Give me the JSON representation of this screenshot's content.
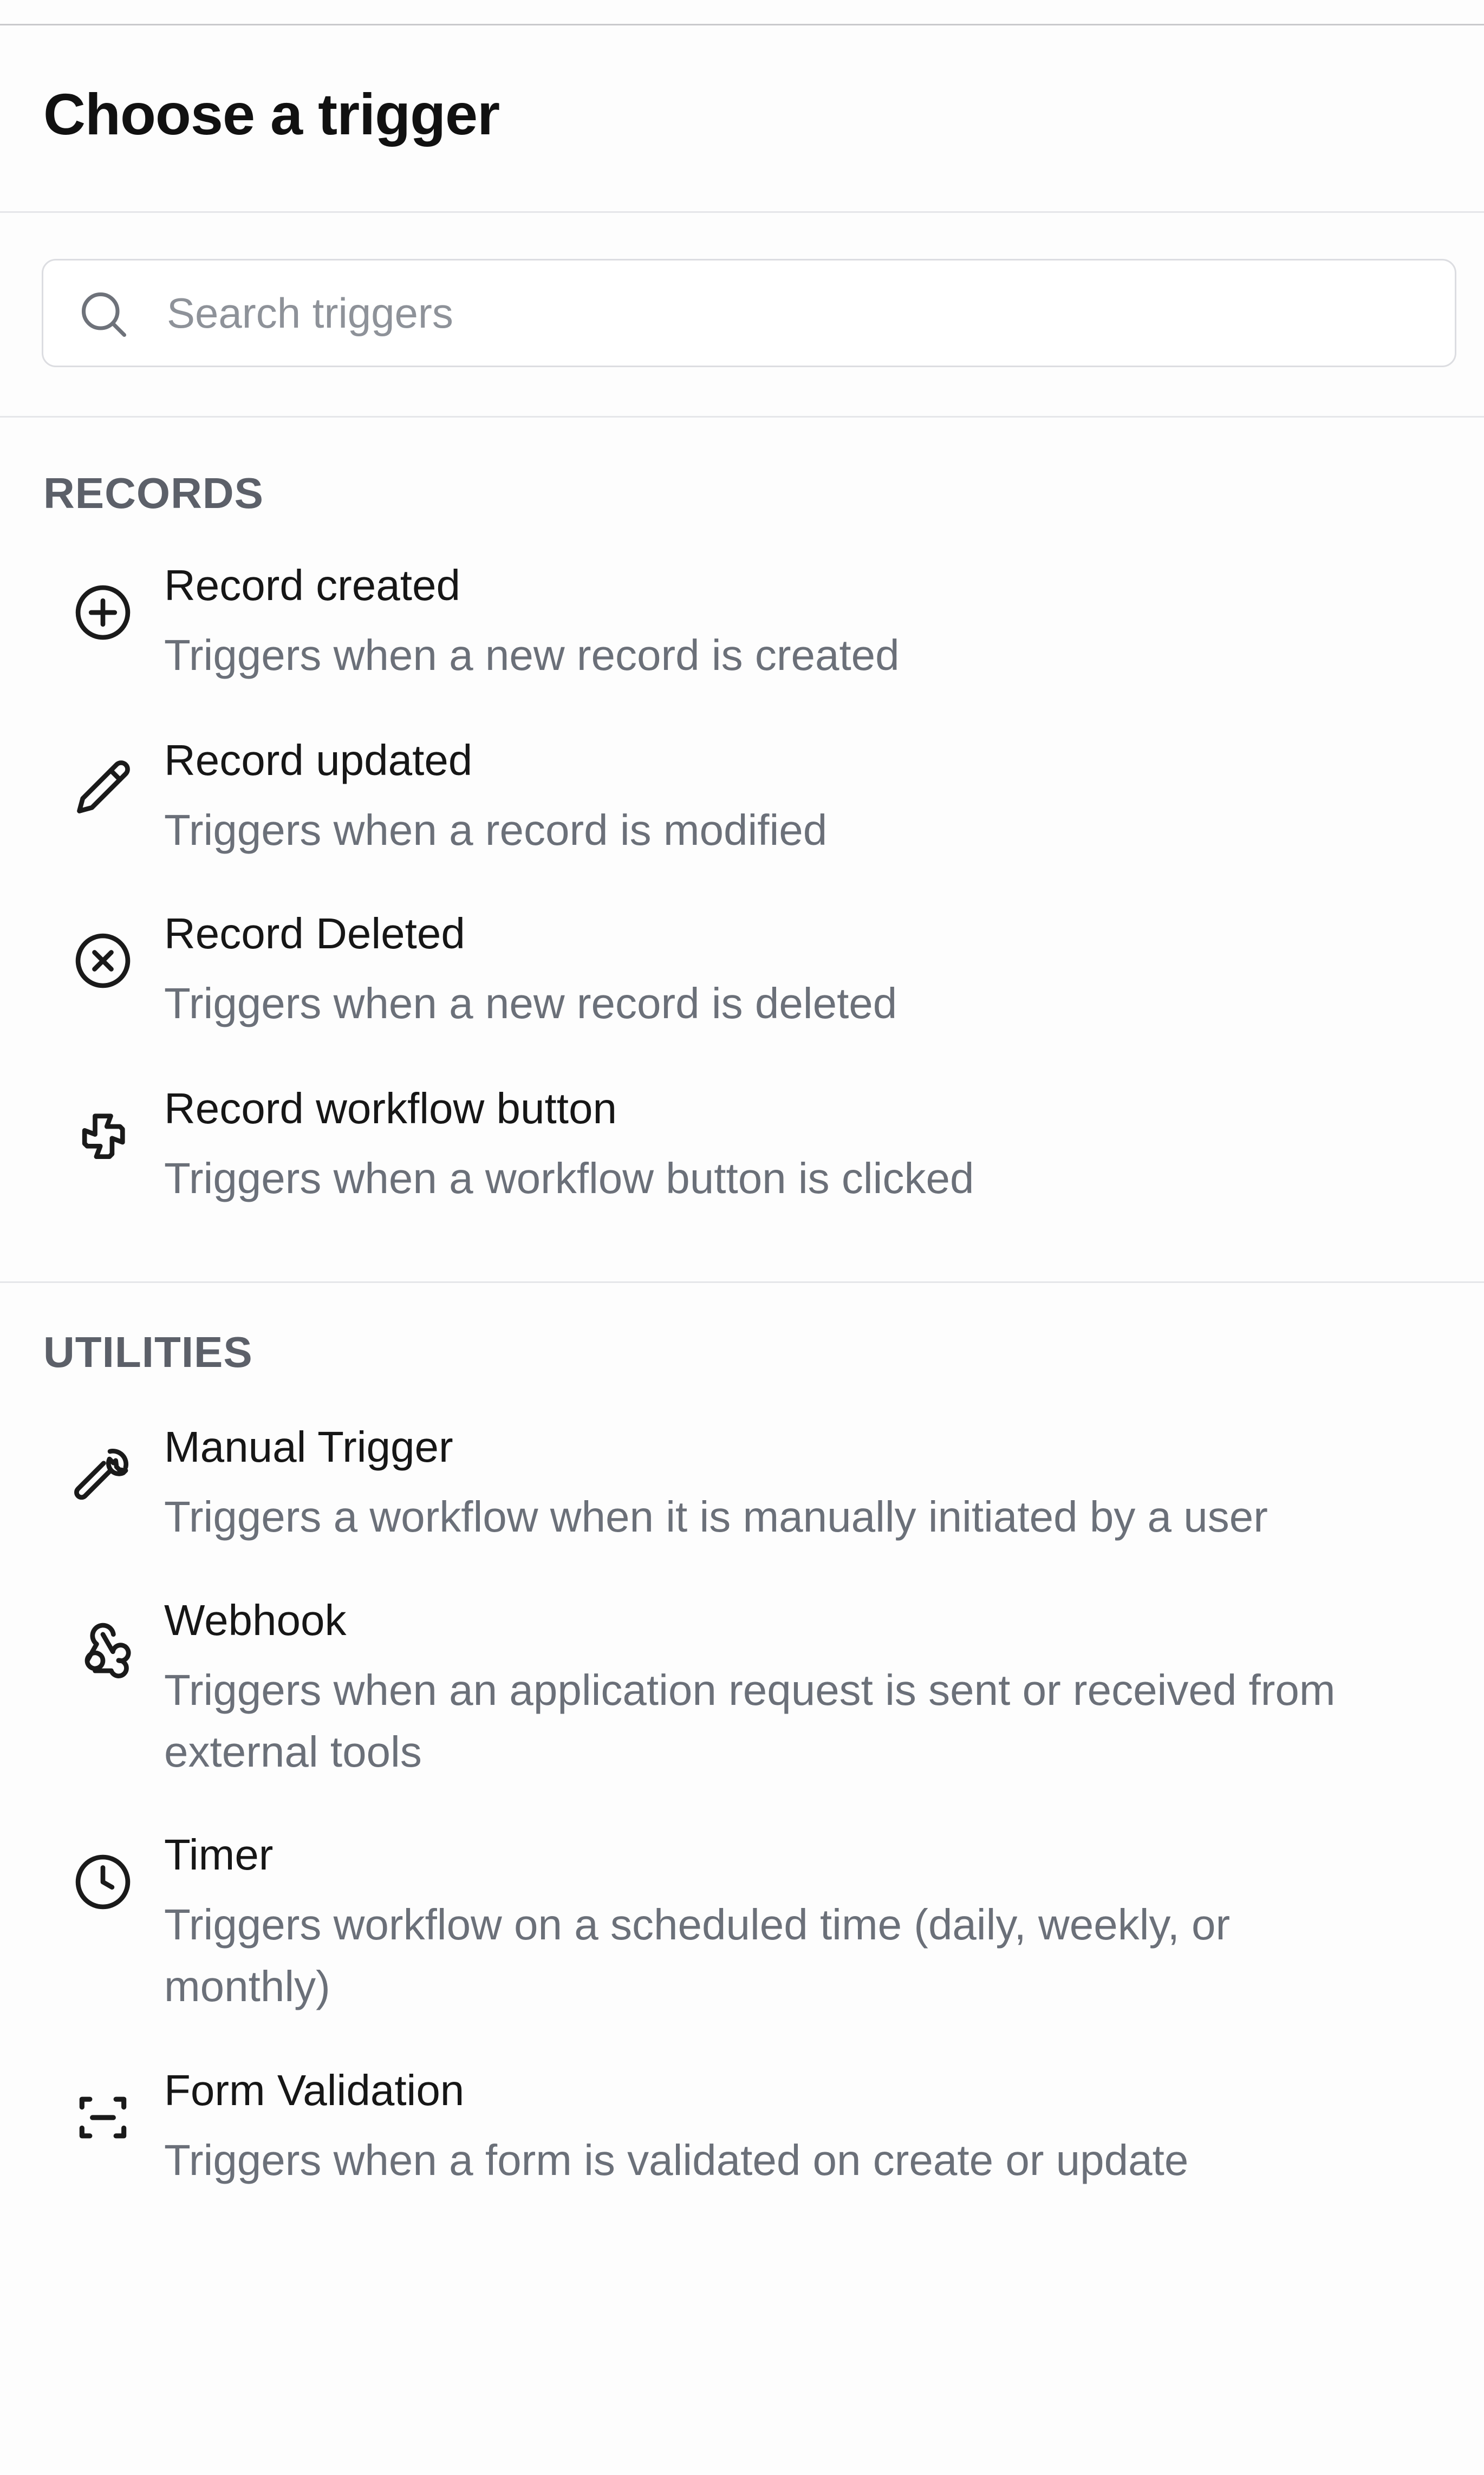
{
  "header": {
    "title": "Choose a trigger"
  },
  "search": {
    "placeholder": "Search triggers",
    "value": "",
    "icon": "search-icon"
  },
  "sections": [
    {
      "heading": "RECORDS",
      "items": [
        {
          "icon": "plus-circle-icon",
          "label": "Record created",
          "description": "Triggers when a new record is created"
        },
        {
          "icon": "pencil-icon",
          "label": "Record updated",
          "description": "Triggers when a record is modified"
        },
        {
          "icon": "x-circle-icon",
          "label": "Record Deleted",
          "description": "Triggers when a new record is deleted"
        },
        {
          "icon": "pointer-cross-icon",
          "label": "Record workflow button",
          "description": "Triggers when a workflow button is clicked"
        }
      ]
    },
    {
      "heading": "UTILITIES",
      "items": [
        {
          "icon": "wrench-icon",
          "label": "Manual Trigger",
          "description": "Triggers a workflow when it is manually initiated by a user"
        },
        {
          "icon": "webhook-icon",
          "label": "Webhook",
          "description": "Triggers when an application request is sent or received from external tools"
        },
        {
          "icon": "clock-icon",
          "label": "Timer",
          "description": "Triggers workflow on a scheduled time (daily, weekly, or monthly)"
        },
        {
          "icon": "scan-frame-icon",
          "label": "Form Validation",
          "description": "Triggers when a form is validated on create or update"
        }
      ]
    }
  ]
}
